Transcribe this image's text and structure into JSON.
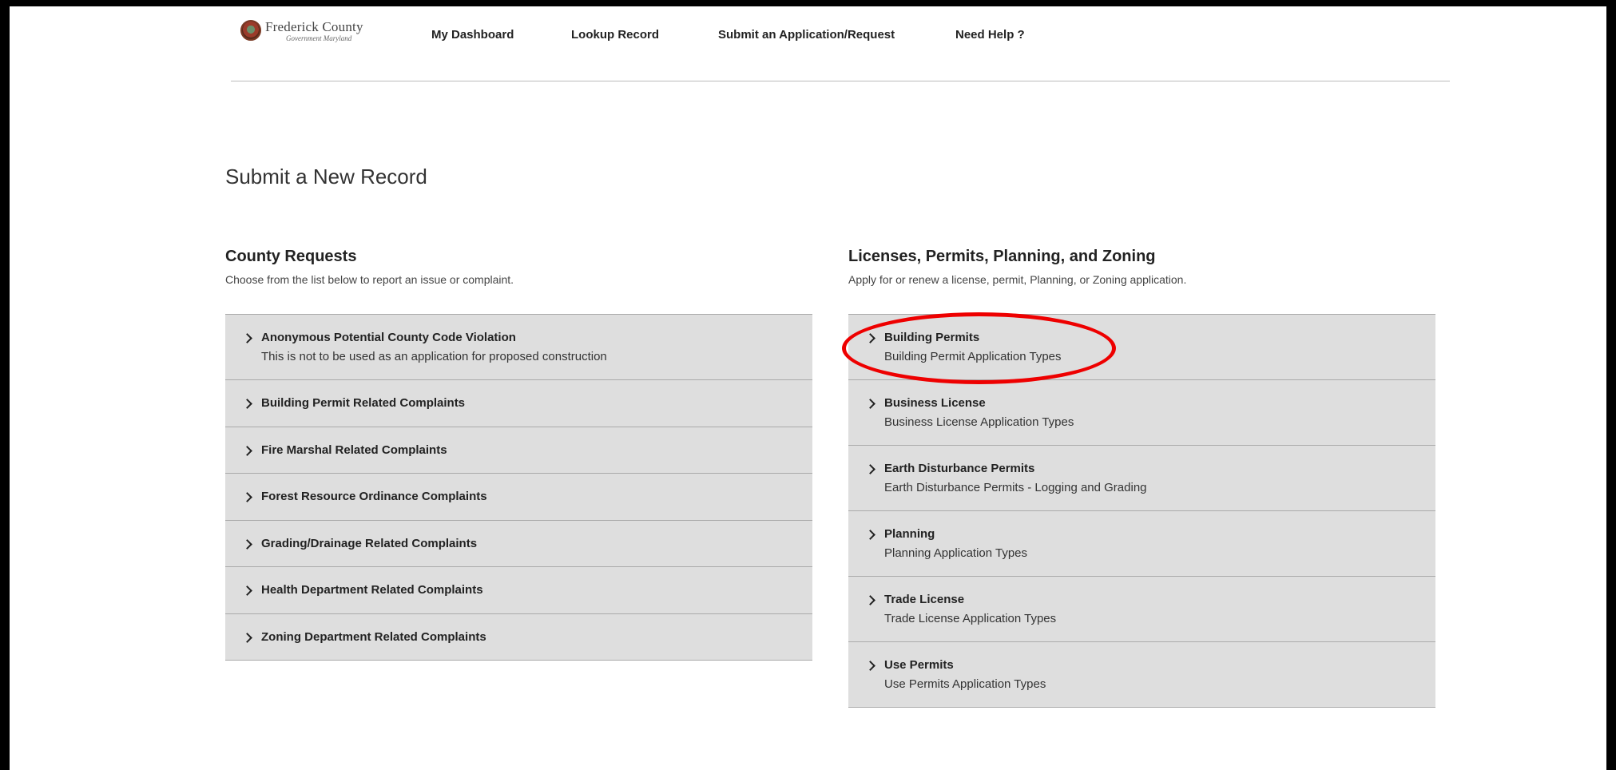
{
  "header": {
    "logo": {
      "name": "Frederick County",
      "sub": "Government Maryland"
    },
    "nav": [
      "My Dashboard",
      "Lookup Record",
      "Submit an Application/Request",
      "Need Help ?"
    ]
  },
  "page_title": "Submit a New Record",
  "county_requests": {
    "title": "County Requests",
    "description": "Choose from the list below to report an issue or complaint.",
    "items": [
      {
        "title": "Anonymous Potential County Code Violation",
        "subtitle": "This is not to be used as an application for proposed construction"
      },
      {
        "title": "Building Permit Related Complaints"
      },
      {
        "title": "Fire Marshal Related Complaints"
      },
      {
        "title": "Forest Resource Ordinance Complaints"
      },
      {
        "title": "Grading/Drainage Related Complaints"
      },
      {
        "title": "Health Department Related Complaints"
      },
      {
        "title": "Zoning Department Related Complaints"
      }
    ]
  },
  "licenses": {
    "title": "Licenses, Permits, Planning, and Zoning",
    "description": "Apply for or renew a license, permit, Planning, or Zoning application.",
    "items": [
      {
        "title": "Building Permits",
        "subtitle": "Building Permit Application Types"
      },
      {
        "title": "Business License",
        "subtitle": "Business License Application Types"
      },
      {
        "title": "Earth Disturbance Permits",
        "subtitle": "Earth Disturbance Permits - Logging and Grading"
      },
      {
        "title": "Planning",
        "subtitle": "Planning Application Types"
      },
      {
        "title": "Trade License",
        "subtitle": "Trade License Application Types"
      },
      {
        "title": "Use Permits",
        "subtitle": "Use Permits Application Types"
      }
    ]
  },
  "colors": {
    "highlight": "#e00000",
    "item_bg": "#dedede"
  }
}
